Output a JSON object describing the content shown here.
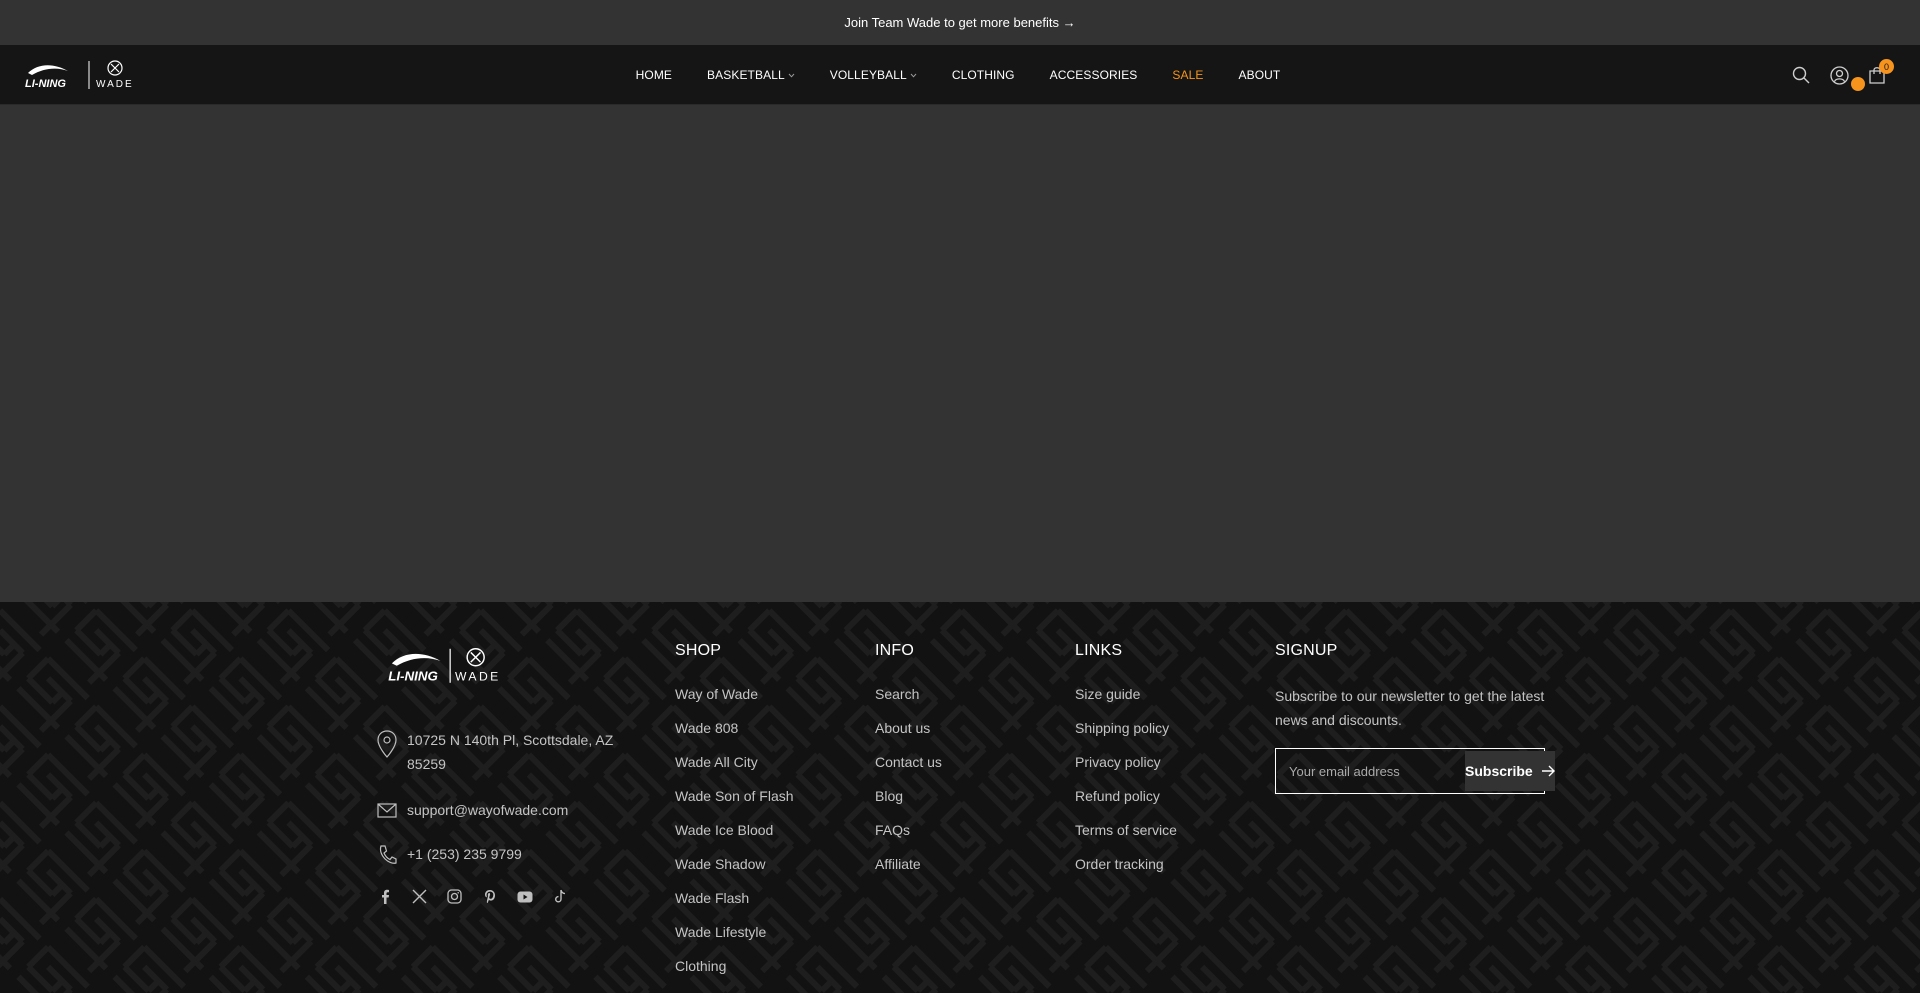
{
  "announcement": {
    "text": "Join Team Wade to get more benefits →"
  },
  "brand": {
    "name_left": "LI-NING",
    "name_right": "WADE"
  },
  "nav": {
    "items": [
      {
        "label": "HOME",
        "dropdown": false,
        "sale": false
      },
      {
        "label": "BASKETBALL",
        "dropdown": true,
        "sale": false
      },
      {
        "label": "VOLLEYBALL",
        "dropdown": true,
        "sale": false
      },
      {
        "label": "CLOTHING",
        "dropdown": false,
        "sale": false
      },
      {
        "label": "ACCESSORIES",
        "dropdown": false,
        "sale": false
      },
      {
        "label": "SALE",
        "dropdown": false,
        "sale": true
      },
      {
        "label": "ABOUT",
        "dropdown": false,
        "sale": false
      }
    ]
  },
  "header_icons": {
    "search": "search-icon",
    "account": "account-icon",
    "cart": "cart-icon",
    "cart_count": "0"
  },
  "colors": {
    "accent": "#f7941d",
    "header_bg": "#151515",
    "page_bg": "#333333",
    "footer_bg": "#121212"
  },
  "footer": {
    "address": "10725 N 140th Pl, Scottsdale, AZ 85259",
    "email": "support@wayofwade.com",
    "phone": "+1 (253) 235 9799",
    "socials": [
      "facebook-icon",
      "x-icon",
      "instagram-icon",
      "pinterest-icon",
      "youtube-icon",
      "tiktok-icon"
    ],
    "shop": {
      "heading": "SHOP",
      "links": [
        "Way of Wade",
        "Wade 808",
        "Wade All City",
        "Wade Son of Flash",
        "Wade Ice Blood",
        "Wade Shadow",
        "Wade Flash",
        "Wade Lifestyle",
        "Clothing"
      ]
    },
    "info": {
      "heading": "INFO",
      "links": [
        "Search",
        "About us",
        "Contact us",
        "Blog",
        "FAQs",
        "Affiliate"
      ]
    },
    "links": {
      "heading": "LINKS",
      "links": [
        "Size guide",
        "Shipping policy",
        "Privacy policy",
        "Refund policy",
        "Terms of service",
        "Order tracking"
      ]
    },
    "signup": {
      "heading": "SIGNUP",
      "text": "Subscribe to our newsletter to get the latest news and discounts.",
      "placeholder": "Your email address",
      "button": "Subscribe"
    }
  }
}
